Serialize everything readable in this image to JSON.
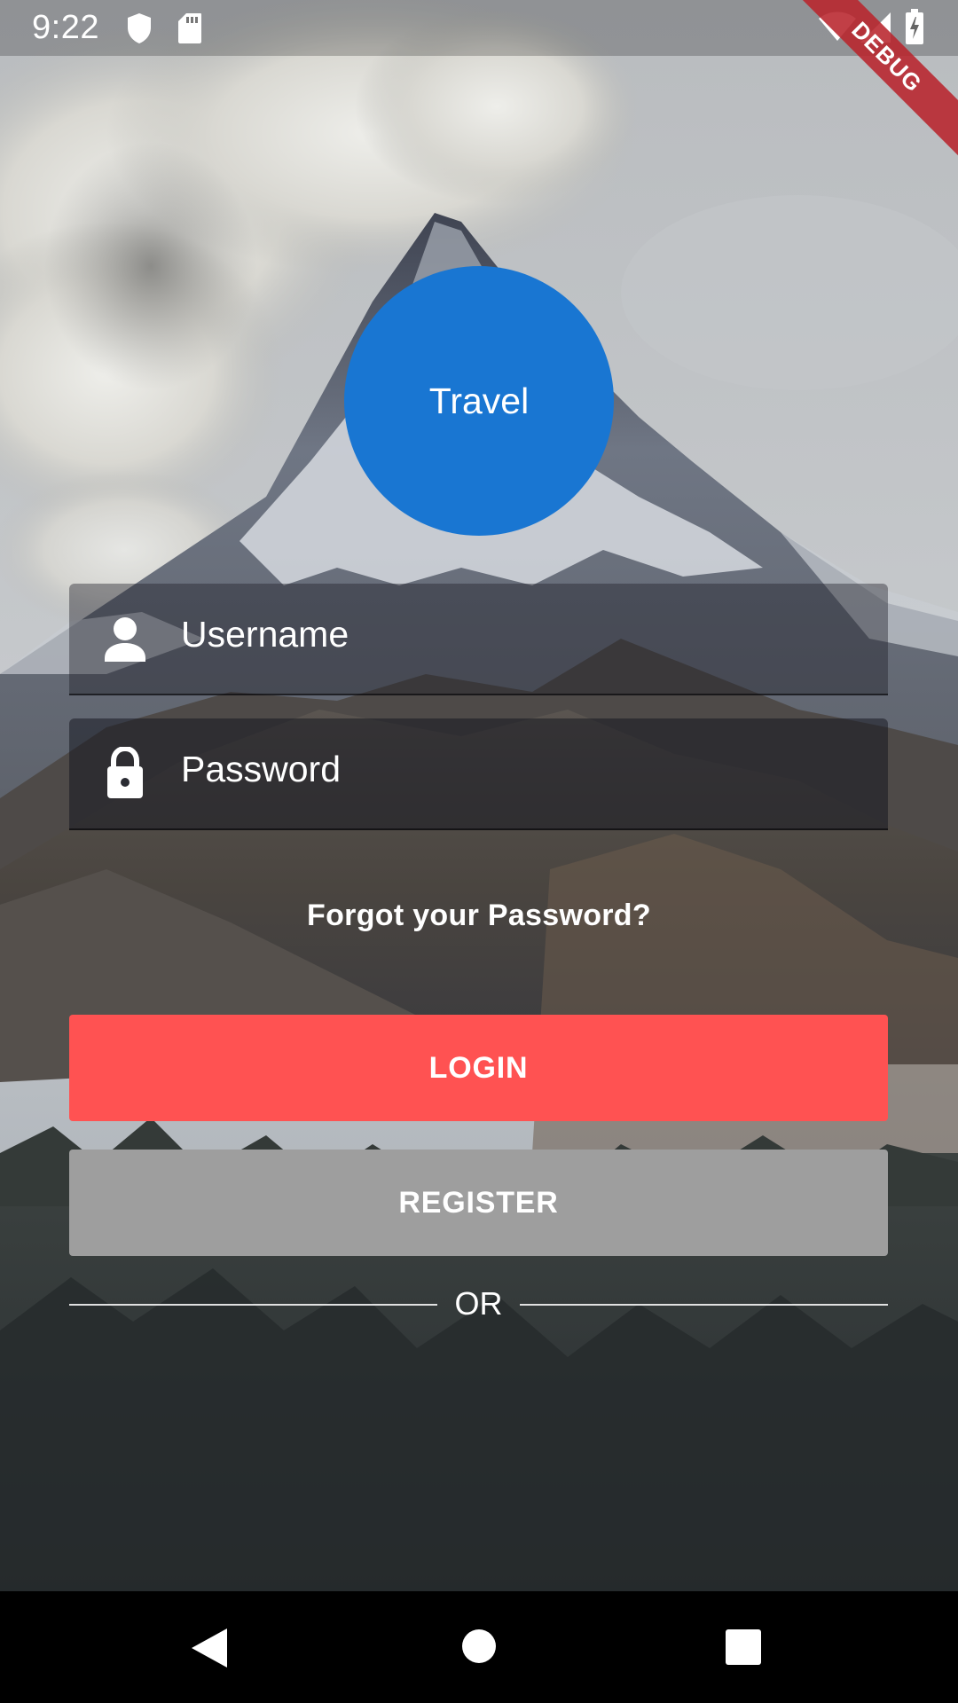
{
  "status_bar": {
    "time": "9:22",
    "left_icons": [
      "shield-icon",
      "sd-card-icon"
    ],
    "right_icons": [
      "wifi-icon",
      "cell-signal-icon",
      "battery-charging-icon"
    ]
  },
  "debug_banner": "DEBUG",
  "logo": {
    "label": "Travel",
    "color": "#1976D2"
  },
  "username": {
    "placeholder": "Username",
    "icon": "person-icon"
  },
  "password": {
    "placeholder": "Password",
    "icon": "lock-icon"
  },
  "forgot_link": "Forgot your Password?",
  "buttons": {
    "login": "LOGIN",
    "login_color": "#FF5252",
    "register": "REGISTER",
    "register_color": "#9E9E9E"
  },
  "divider": {
    "label": "OR"
  },
  "nav_bar": {
    "icons": [
      "back-icon",
      "home-icon",
      "recents-icon"
    ]
  }
}
